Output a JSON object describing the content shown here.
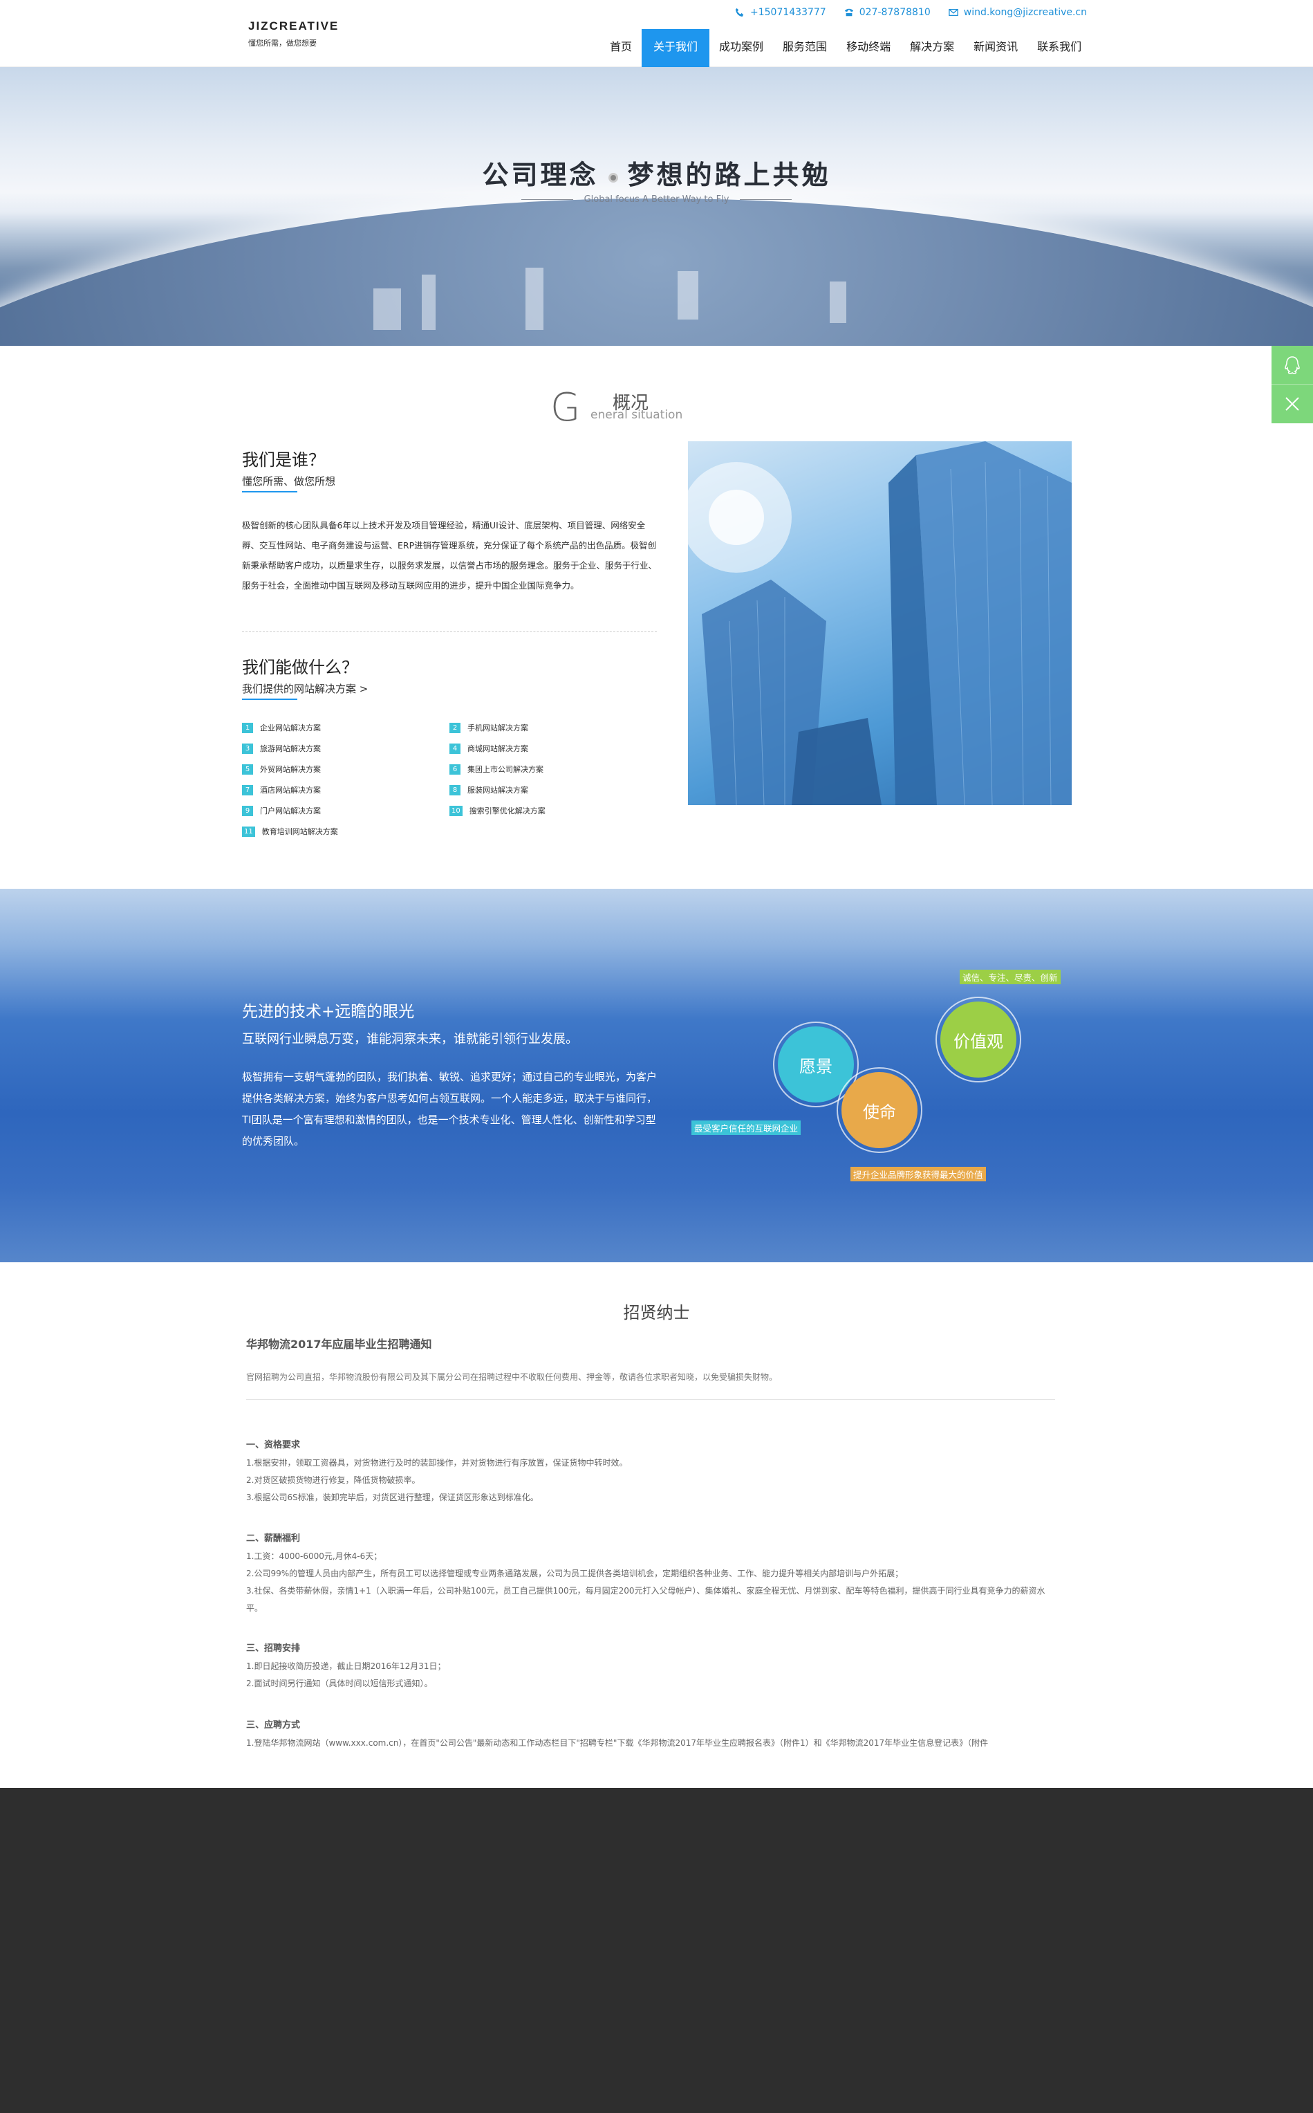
{
  "header": {
    "logo": "JIZCREATIVE",
    "logo_tagline": "懂您所需，做您想要",
    "phone": "+15071433777",
    "tel": "027-87878810",
    "email": "wind.kong@jizcreative.cn",
    "nav": [
      "首页",
      "关于我们",
      "成功案例",
      "服务范围",
      "移动终端",
      "解决方案",
      "新闻资讯",
      "联系我们"
    ],
    "active_nav": "关于我们"
  },
  "banner": {
    "title_left": "公司理念",
    "title_right": "梦想的路上共勉",
    "subtitle": "Global focus A Better Way to Fly"
  },
  "overview": {
    "glyph": "G",
    "title": "概况",
    "en": "eneral situation",
    "who_heading": "我们是谁？",
    "who_sub": "懂您所需、做您所想",
    "who_body": "极智创新的核心团队具备6年以上技术开发及项目管理经验，精通UI设计、底层架构、项目管理、网络安全孵、交互性网站、电子商务建设与运营、ERP进销存管理系统，充分保证了每个系统产品的出色品质。极智创新秉承帮助客户成功，以质量求生存，以服务求发展，以信誉占市场的服务理念。服务于企业、服务于行业、服务于社会，全面推动中国互联网及移动互联网应用的进步，提升中国企业国际竞争力。",
    "what_heading": "我们能做什么？",
    "what_sub": "我们提供的网站解决方案 >",
    "solutions": [
      {
        "num": "1",
        "label": "企业网站解决方案"
      },
      {
        "num": "2",
        "label": "手机网站解决方案"
      },
      {
        "num": "3",
        "label": "旅游网站解决方案"
      },
      {
        "num": "4",
        "label": "商城网站解决方案"
      },
      {
        "num": "5",
        "label": "外贸网站解决方案"
      },
      {
        "num": "6",
        "label": "集团上市公司解决方案"
      },
      {
        "num": "7",
        "label": "酒店网站解决方案"
      },
      {
        "num": "8",
        "label": "服装网站解决方案"
      },
      {
        "num": "9",
        "label": "门户网站解决方案"
      },
      {
        "num": "10",
        "label": "搜索引擎优化解决方案"
      },
      {
        "num": "11",
        "label": "教育培训网站解决方案"
      }
    ]
  },
  "vision": {
    "title": "先进的技术+远瞻的眼光",
    "subtitle": "互联网行业瞬息万变，谁能洞察未来，谁就能引领行业发展。",
    "body": "极智拥有一支朝气蓬勃的团队，我们执着、敏锐、追求更好；通过自己的专业眼光，为客户提供各类解决方案，始终为客户思考如何占领互联网。一个人能走多远，取决于与谁同行，TI团队是一个富有理想和激情的团队，也是一个技术专业化、管理人性化、创新性和学习型的优秀团队。",
    "circles": {
      "vision": "愿景",
      "mission": "使命",
      "values": "价值观"
    },
    "tags": {
      "values": "诚信、专注、尽责、创新",
      "vision": "最受客户信任的互联网企业",
      "mission": "提升企业品牌形象获得最大的价值"
    },
    "colors": {
      "vision": "#3cc3d8",
      "mission": "#e8a94a",
      "values": "#9ccf46"
    }
  },
  "recruit": {
    "title": "招贤纳士",
    "job_title": "华邦物流2017年应届毕业生招聘通知",
    "intro": "官网招聘为公司直招，华邦物流股份有限公司及其下属分公司在招聘过程中不收取任何费用、押金等，敬请各位求职者知晓，以免受骗损失财物。",
    "sections": [
      {
        "heading": "一、资格要求",
        "lines": [
          "1.根据安排，领取工资器具，对货物进行及时的装卸操作，并对货物进行有序放置，保证货物中转时效。",
          "2.对货区破损货物进行修复，降低货物破损率。",
          "3.根据公司6S标准，装卸完毕后，对货区进行整理，保证货区形象达到标准化。"
        ]
      },
      {
        "heading": "二、薪酬福利",
        "lines": [
          "1.工资：4000-6000元,月休4-6天；",
          "2.公司99%的管理人员由内部产生，所有员工可以选择管理或专业两条通路发展，公司为员工提供各类培训机会，定期组织各种业务、工作、能力提升等相关内部培训与户外拓展；",
          "3.社保、各类带薪休假，亲情1+1（入职满一年后，公司补贴100元，员工自己提供100元，每月固定200元打入父母帐户）、集体婚礼、家庭全程无忧、月饼到家、配车等特色福利，提供高于同行业具有竞争力的薪资水平。"
        ]
      },
      {
        "heading": "三、招聘安排",
        "lines": [
          "1.即日起接收简历投递，截止日期2016年12月31日；",
          "2.面试时间另行通知（具体时间以短信形式通知）。"
        ]
      },
      {
        "heading": "三、应聘方式",
        "lines": [
          "1.登陆华邦物流网站（www.xxx.com.cn），在首页\"公司公告\"最新动态和工作动态栏目下\"招聘专栏\"下载《华邦物流2017年毕业生应聘报名表》（附件1）和《华邦物流2017年毕业生信息登记表》（附件"
        ]
      }
    ]
  }
}
